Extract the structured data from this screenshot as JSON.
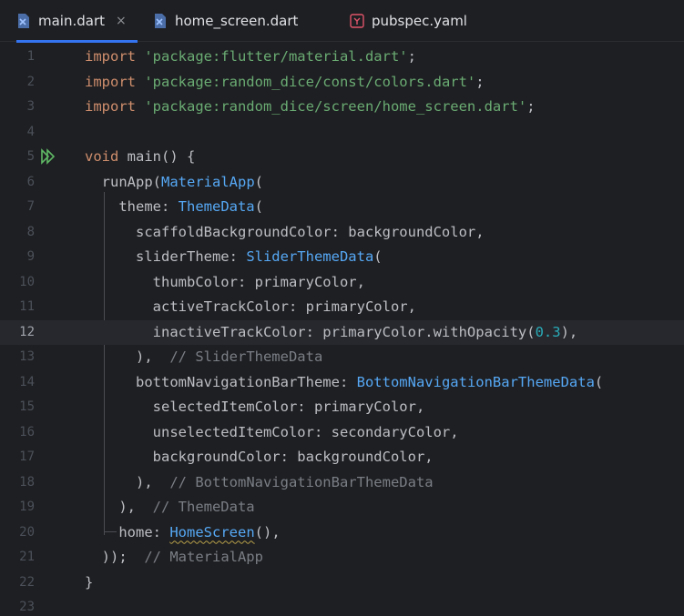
{
  "tabs": [
    {
      "label": "main.dart",
      "close": "×",
      "icon": "dart-file-icon"
    },
    {
      "label": "home_screen.dart",
      "icon": "dart-file-icon"
    },
    {
      "label": "pubspec.yaml",
      "icon": "yaml-file-icon"
    }
  ],
  "line_numbers": [
    "1",
    "2",
    "3",
    "4",
    "5",
    "6",
    "7",
    "8",
    "9",
    "10",
    "11",
    "12",
    "13",
    "14",
    "15",
    "16",
    "17",
    "18",
    "19",
    "20",
    "21",
    "22",
    "23"
  ],
  "current_line": 12,
  "code": {
    "l1": {
      "kw": "import ",
      "str": "'package:flutter/material.dart'",
      "end": ";"
    },
    "l2": {
      "kw": "import ",
      "str": "'package:random_dice/const/colors.dart'",
      "end": ";"
    },
    "l3": {
      "kw": "import ",
      "str": "'package:random_dice/screen/home_screen.dart'",
      "end": ";"
    },
    "l5": {
      "kw": "void ",
      "name": "main",
      "rest": "() {"
    },
    "l6": {
      "a": "  runApp(",
      "cls": "MaterialApp",
      "b": "("
    },
    "l7": {
      "a": "    theme: ",
      "cls": "ThemeData",
      "b": "("
    },
    "l8": {
      "a": "      scaffoldBackgroundColor: backgroundColor,"
    },
    "l9": {
      "a": "      sliderTheme: ",
      "cls": "SliderThemeData",
      "b": "("
    },
    "l10": {
      "a": "        thumbColor: primaryColor,"
    },
    "l11": {
      "a": "        activeTrackColor: primaryColor,"
    },
    "l12": {
      "a": "        inactiveTrackColor: primaryColor.withOpacity(",
      "num": "0.3",
      "b": "),"
    },
    "l13": {
      "a": "      ),  ",
      "cmt": "// SliderThemeData"
    },
    "l14": {
      "a": "      bottomNavigationBarTheme: ",
      "cls": "BottomNavigationBarThemeData",
      "b": "("
    },
    "l15": {
      "a": "        selectedItemColor: primaryColor,"
    },
    "l16": {
      "a": "        unselectedItemColor: secondaryColor,"
    },
    "l17": {
      "a": "        backgroundColor: backgroundColor,"
    },
    "l18": {
      "a": "      ),  ",
      "cmt": "// BottomNavigationBarThemeData"
    },
    "l19": {
      "a": "    ),  ",
      "cmt": "// ThemeData"
    },
    "l20": {
      "a": "    home: ",
      "cls": "HomeScreen",
      "b": "(),"
    },
    "l21": {
      "a": "  ));  ",
      "cmt": "// MaterialApp"
    },
    "l22": {
      "a": "}"
    }
  },
  "colors": {
    "background": "#1e1f22",
    "keyword": "#cf8e6d",
    "string": "#6aab73",
    "class": "#56a8f5",
    "number": "#2aacb8",
    "comment": "#7a7e85",
    "tab_accent": "#3574f0",
    "run_icon": "#5fb865"
  }
}
